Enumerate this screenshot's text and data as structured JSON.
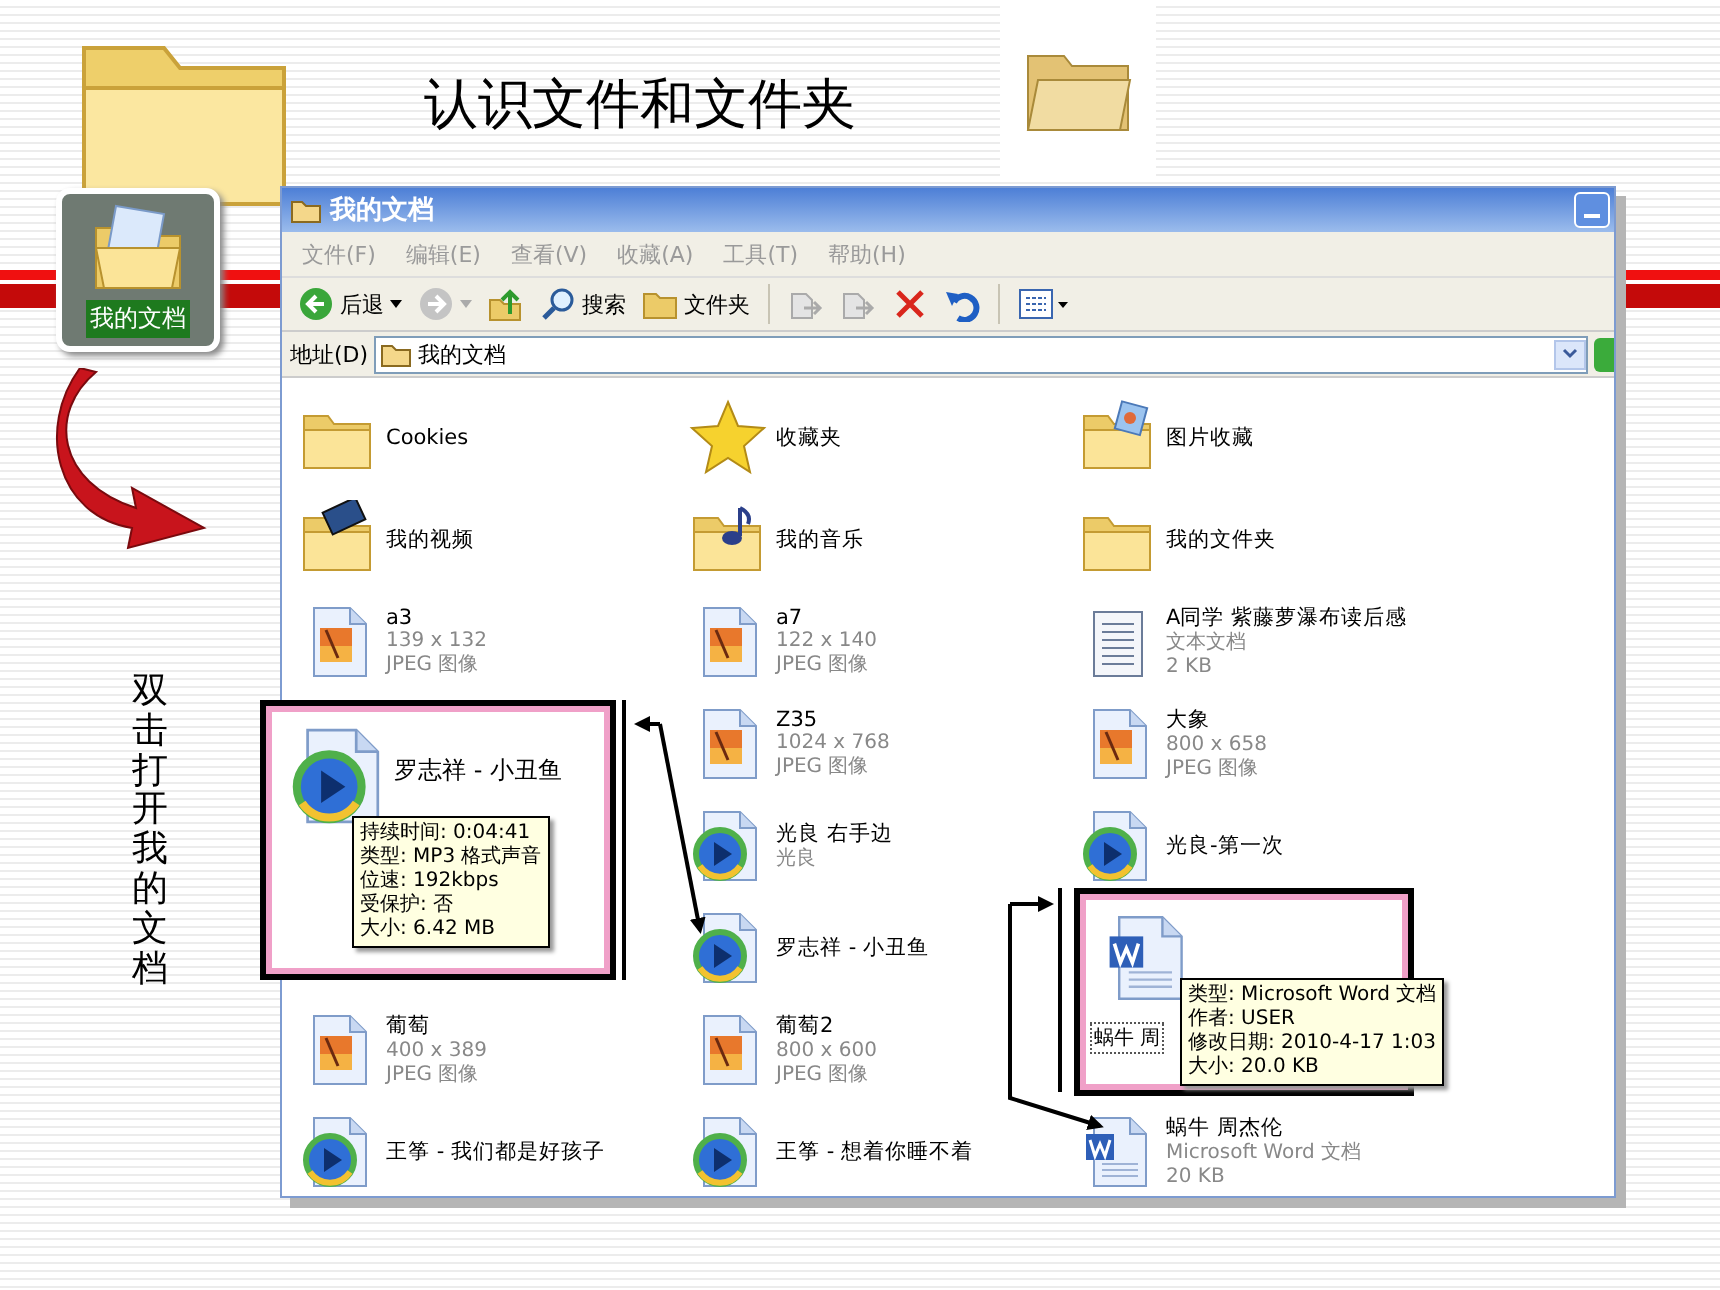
{
  "slide": {
    "title": "认识文件和文件夹",
    "desktop_icon": {
      "label": "我的文档"
    },
    "caption": "双击打开我的文档"
  },
  "window": {
    "title": "我的文档",
    "menu": [
      "文件(F)",
      "编辑(E)",
      "查看(V)",
      "收藏(A)",
      "工具(T)",
      "帮助(H)"
    ],
    "toolbar": [
      {
        "kind": "back",
        "label": "后退"
      },
      {
        "kind": "forward"
      },
      {
        "kind": "up"
      },
      {
        "kind": "search",
        "label": "搜索"
      },
      {
        "kind": "folders",
        "label": "文件夹"
      },
      {
        "kind": "move"
      },
      {
        "kind": "copy"
      },
      {
        "kind": "delete"
      },
      {
        "kind": "undo"
      },
      {
        "kind": "views"
      }
    ],
    "address": {
      "label": "地址(D)",
      "value": "我的文档"
    }
  },
  "rows": [
    [
      {
        "kind": "folder",
        "name": "Cookies"
      },
      {
        "kind": "favorites",
        "name": "收藏夹"
      },
      {
        "kind": "pictures",
        "name": "图片收藏"
      }
    ],
    [
      {
        "kind": "videos",
        "name": "我的视频"
      },
      {
        "kind": "music",
        "name": "我的音乐"
      },
      {
        "kind": "folder",
        "name": "我的文件夹"
      }
    ],
    [
      {
        "kind": "image",
        "name": "a3",
        "details": [
          "139 x 132",
          "JPEG 图像"
        ]
      },
      {
        "kind": "image",
        "name": "a7",
        "details": [
          "122 x 140",
          "JPEG 图像"
        ]
      },
      {
        "kind": "text",
        "name": "A同学 紫藤萝瀑布读后感",
        "details": [
          "文本文档",
          "2 KB"
        ]
      }
    ],
    [
      null,
      {
        "kind": "image",
        "name": "Z35",
        "details": [
          "1024 x 768",
          "JPEG 图像"
        ]
      },
      {
        "kind": "image",
        "name": "大象",
        "details": [
          "800 x 658",
          "JPEG 图像"
        ]
      }
    ],
    [
      null,
      {
        "kind": "media",
        "name": "光良 右手边",
        "details": [
          "光良"
        ]
      },
      {
        "kind": "media",
        "name": "光良-第一次"
      }
    ],
    [
      null,
      {
        "kind": "media",
        "name": "罗志祥 - 小丑鱼"
      },
      null
    ],
    [
      {
        "kind": "image",
        "name": "葡萄",
        "details": [
          "400 x 389",
          "JPEG 图像"
        ]
      },
      {
        "kind": "image",
        "name": "葡萄2",
        "details": [
          "800 x 600",
          "JPEG 图像"
        ]
      },
      null
    ],
    [
      {
        "kind": "media",
        "name": "王筝 - 我们都是好孩子"
      },
      {
        "kind": "media",
        "name": "王筝 - 想着你睡不着"
      },
      {
        "kind": "word",
        "name": "蜗牛  周杰伦",
        "details": [
          "Microsoft Word 文档",
          "20 KB"
        ]
      }
    ]
  ],
  "callouts": [
    {
      "kind": "media",
      "name": "罗志祥 - 小丑鱼",
      "tooltip": [
        "持续时间: 0:04:41",
        "类型: MP3 格式声音",
        "位速: 192kbps",
        "受保护: 否",
        "大小: 6.42 MB"
      ]
    },
    {
      "kind": "word",
      "name": "蜗牛  周",
      "tooltip": [
        "类型: Microsoft Word 文档",
        "作者: USER",
        "修改日期: 2010-4-17 1:03",
        "大小: 20.0 KB"
      ]
    }
  ]
}
